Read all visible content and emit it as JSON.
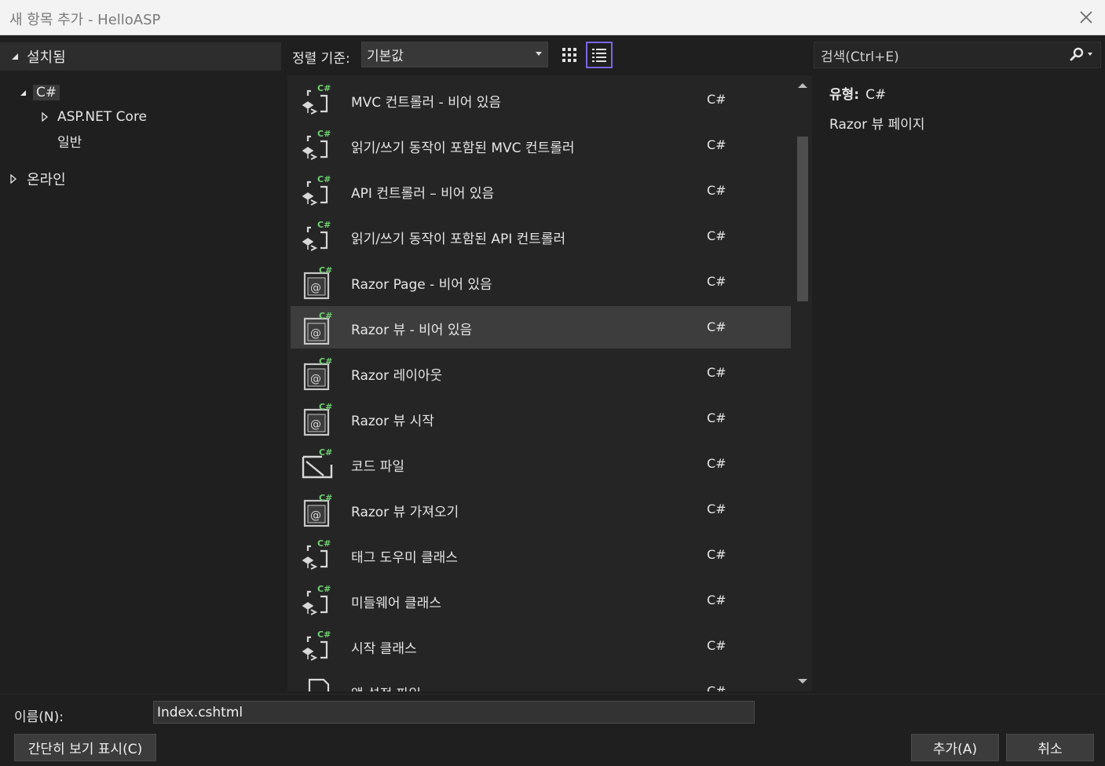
{
  "window": {
    "title": "새 항목 추가 - HelloASP"
  },
  "left": {
    "header": "설치됨",
    "tree": {
      "root": "C#",
      "child1": "ASP.NET Core",
      "child2": "일반",
      "online": "온라인"
    }
  },
  "toolbar": {
    "sort_label": "정렬 기준:",
    "sort_value": "기본값"
  },
  "templates": [
    {
      "name": "MVC 컨트롤러 - 비어 있음",
      "lang": "C#",
      "icon": "class-icon"
    },
    {
      "name": "읽기/쓰기 동작이 포함된 MVC 컨트롤러",
      "lang": "C#",
      "icon": "class-icon"
    },
    {
      "name": "API 컨트롤러 – 비어 있음",
      "lang": "C#",
      "icon": "class-icon"
    },
    {
      "name": "읽기/쓰기 동작이 포함된 API 컨트롤러",
      "lang": "C#",
      "icon": "class-icon"
    },
    {
      "name": "Razor Page - 비어 있음",
      "lang": "C#",
      "icon": "razor-icon"
    },
    {
      "name": "Razor 뷰 - 비어 있음",
      "lang": "C#",
      "icon": "razor-icon"
    },
    {
      "name": "Razor 레이아웃",
      "lang": "C#",
      "icon": "razor-icon"
    },
    {
      "name": "Razor 뷰 시작",
      "lang": "C#",
      "icon": "razor-icon"
    },
    {
      "name": "코드 파일",
      "lang": "C#",
      "icon": "code-file-icon"
    },
    {
      "name": "Razor 뷰 가져오기",
      "lang": "C#",
      "icon": "razor-icon"
    },
    {
      "name": "태그 도우미 클래스",
      "lang": "C#",
      "icon": "class-icon"
    },
    {
      "name": "미들웨어 클래스",
      "lang": "C#",
      "icon": "class-icon"
    },
    {
      "name": "시작 클래스",
      "lang": "C#",
      "icon": "class-icon"
    },
    {
      "name": "앱 설정 파일",
      "lang": "C#",
      "icon": "file-icon"
    }
  ],
  "selected_index": 5,
  "search": {
    "placeholder": "검색(Ctrl+E)"
  },
  "description": {
    "type_label": "유형:",
    "type_value": "C#",
    "name": "Razor 뷰 페이지"
  },
  "bottom": {
    "name_label": "이름(N):",
    "name_value": "Index.cshtml",
    "compact_button": "간단히 보기 표시(C)",
    "add_button": "추가(A)",
    "cancel_button": "취소"
  }
}
